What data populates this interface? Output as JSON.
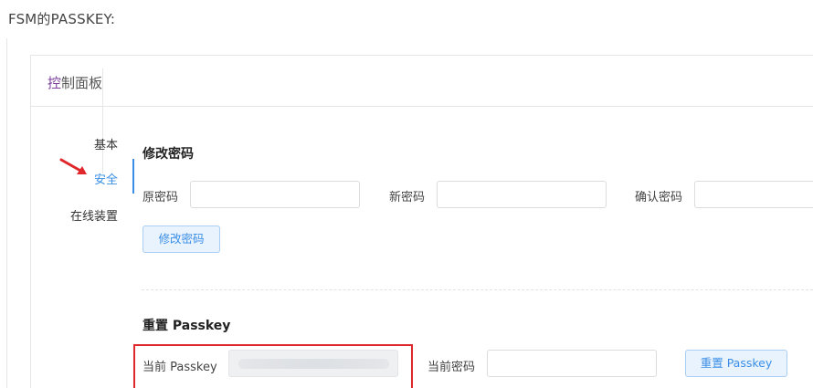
{
  "caption": "FSM的PASSKEY:",
  "panel": {
    "title_glyph": "控",
    "title_rest": "制面板"
  },
  "sidenav": {
    "items": [
      {
        "label": "基本"
      },
      {
        "label": "安全",
        "active": true
      },
      {
        "label": "在线装置"
      }
    ]
  },
  "change_password": {
    "title": "修改密码",
    "old_label": "原密码",
    "new_label": "新密码",
    "confirm_label": "确认密码",
    "submit_label": "修改密码"
  },
  "reset_passkey": {
    "title": "重置 Passkey",
    "current_passkey_label": "当前 Passkey",
    "current_password_label": "当前密码",
    "submit_label": "重置 Passkey"
  },
  "colors": {
    "accent": "#3a8ee6",
    "annotation_red": "#e0272b"
  },
  "icons": {
    "annotation": "red-arrow-icon"
  }
}
